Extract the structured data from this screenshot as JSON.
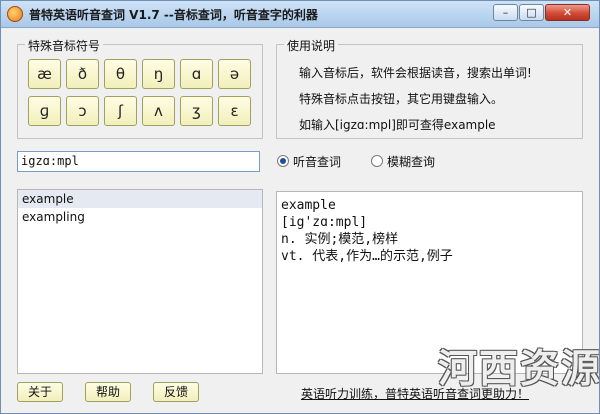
{
  "window": {
    "title": "普特英语听音查词 V1.7 --音标查词，听音查字的利器",
    "controls": {
      "minimize": "–",
      "maximize": "□",
      "close": "✕"
    }
  },
  "symbols": {
    "group_title": "特殊音标符号",
    "row1": [
      "æ",
      "ð",
      "θ",
      "ŋ",
      "ɑ",
      "ə"
    ],
    "row2": [
      "ɡ",
      "ɔ",
      "ʃ",
      "ʌ",
      "ʒ",
      "ɛ"
    ]
  },
  "help": {
    "group_title": "使用说明",
    "lines": [
      "输入音标后，软件会根据读音，搜索出单词!",
      "特殊音标点击按钮，其它用键盘输入。",
      "如输入[igzɑ:mpl]即可查得example"
    ]
  },
  "search": {
    "value": "igzɑ:mpl",
    "modes": [
      {
        "label": "听音查词",
        "checked": true
      },
      {
        "label": "模糊查询",
        "checked": false
      }
    ]
  },
  "results_list": [
    {
      "label": "example",
      "selected": true
    },
    {
      "label": "exampling",
      "selected": false
    }
  ],
  "definition": {
    "lines": [
      "example",
      "[ig'zɑ:mpl]",
      "n. 实例;模范,榜样",
      "vt. 代表,作为…的示范,例子"
    ]
  },
  "footer": {
    "buttons": [
      "关于",
      "帮助",
      "反馈"
    ],
    "promo": "英语听力训练，普特英语听音查词更助力！"
  },
  "watermark": "河西资源",
  "colors": {
    "symbol_button": "#f2efbb",
    "titlebar": "#b9d4ef",
    "close_button": "#d24b37",
    "selection": "#e5e9f2"
  }
}
